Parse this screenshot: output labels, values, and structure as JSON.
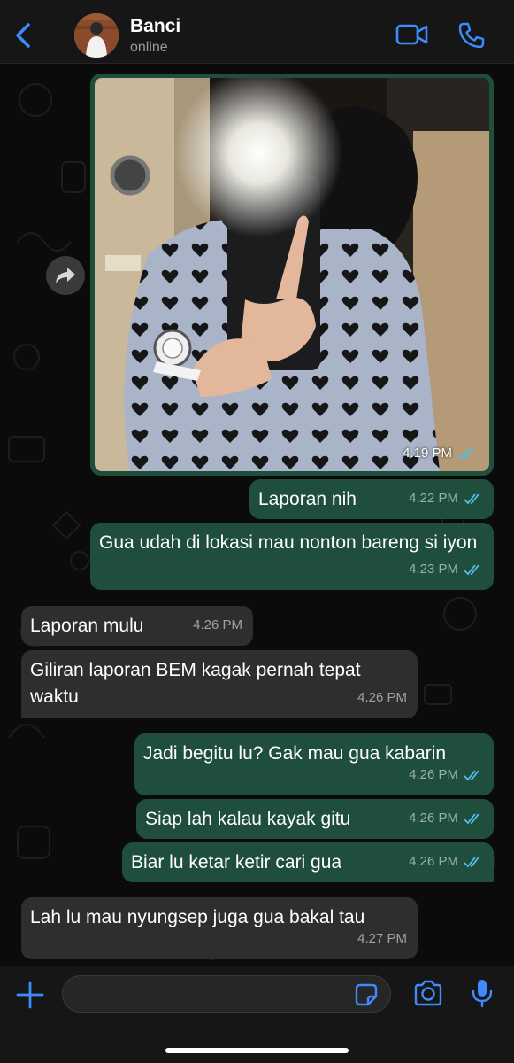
{
  "header": {
    "back_icon": "chevron-left-icon",
    "contact_name": "Banci",
    "status": "online",
    "video_icon": "video-call-icon",
    "phone_icon": "phone-icon"
  },
  "colors": {
    "accent": "#3d8bfd",
    "outgoing_bubble": "#1f4e3d",
    "incoming_bubble": "#2e2e2f",
    "background": "#0b0b0b"
  },
  "photo_message": {
    "time": "4.19 PM",
    "status": "read"
  },
  "messages": [
    {
      "direction": "out",
      "text": "Laporan nih",
      "time": "4.22 PM",
      "status": "read"
    },
    {
      "direction": "out",
      "text": "Gua udah di lokasi mau nonton bareng si iyon",
      "time": "4.23 PM",
      "status": "read"
    },
    {
      "direction": "in",
      "text": "Laporan mulu",
      "time": "4.26 PM"
    },
    {
      "direction": "in",
      "text": "Giliran laporan BEM kagak pernah tepat waktu",
      "time": "4.26 PM"
    },
    {
      "direction": "out",
      "text": "Jadi begitu lu? Gak mau gua kabarin",
      "time": "4.26 PM",
      "status": "read"
    },
    {
      "direction": "out",
      "text": "Siap lah kalau kayak gitu",
      "time": "4.26 PM",
      "status": "read"
    },
    {
      "direction": "out",
      "text": "Biar lu ketar ketir cari gua",
      "time": "4.26 PM",
      "status": "read"
    },
    {
      "direction": "in",
      "text": "Lah lu mau nyungsep juga gua bakal tau",
      "time": "4.27 PM"
    }
  ],
  "composer": {
    "plus_icon": "plus-icon",
    "sticker_icon": "sticker-icon",
    "camera_icon": "camera-icon",
    "mic_icon": "microphone-icon",
    "input_value": ""
  }
}
